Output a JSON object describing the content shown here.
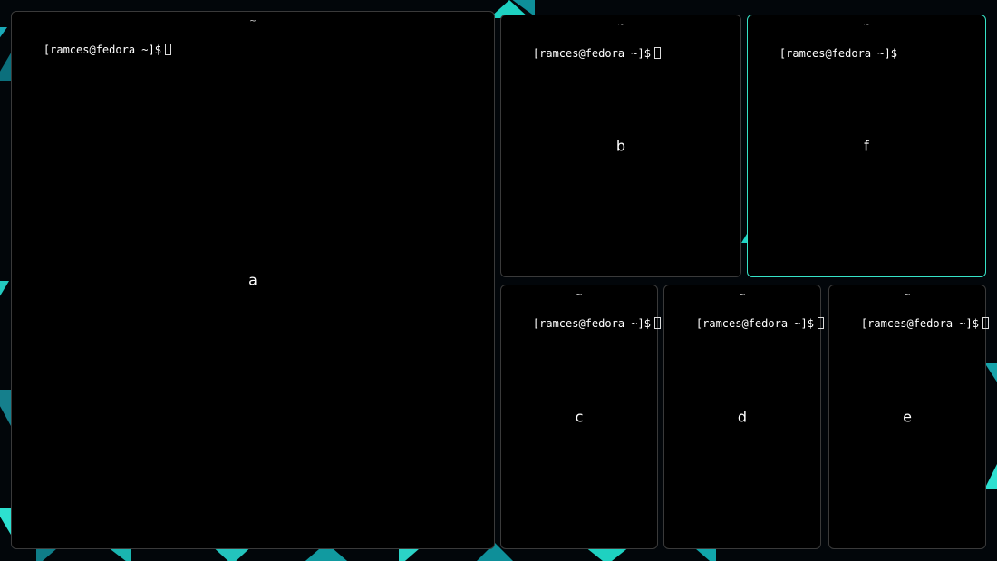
{
  "windows": {
    "a": {
      "title": "~",
      "prompt": "[ramces@fedora ~]$",
      "overlay": "a",
      "show_cursor": true,
      "focused": false
    },
    "b": {
      "title": "~",
      "prompt": "[ramces@fedora ~]$",
      "overlay": "b",
      "show_cursor": true,
      "focused": false
    },
    "f": {
      "title": "~",
      "prompt": "[ramces@fedora ~]$",
      "overlay": "f",
      "show_cursor": false,
      "focused": true
    },
    "c": {
      "title": "~",
      "prompt": "[ramces@fedora ~]$",
      "overlay": "c",
      "show_cursor": true,
      "focused": false
    },
    "d": {
      "title": "~",
      "prompt": "[ramces@fedora ~]$",
      "overlay": "d",
      "show_cursor": true,
      "focused": false
    },
    "e": {
      "title": "~",
      "prompt": "[ramces@fedora ~]$",
      "overlay": "e",
      "show_cursor": true,
      "focused": false
    }
  }
}
